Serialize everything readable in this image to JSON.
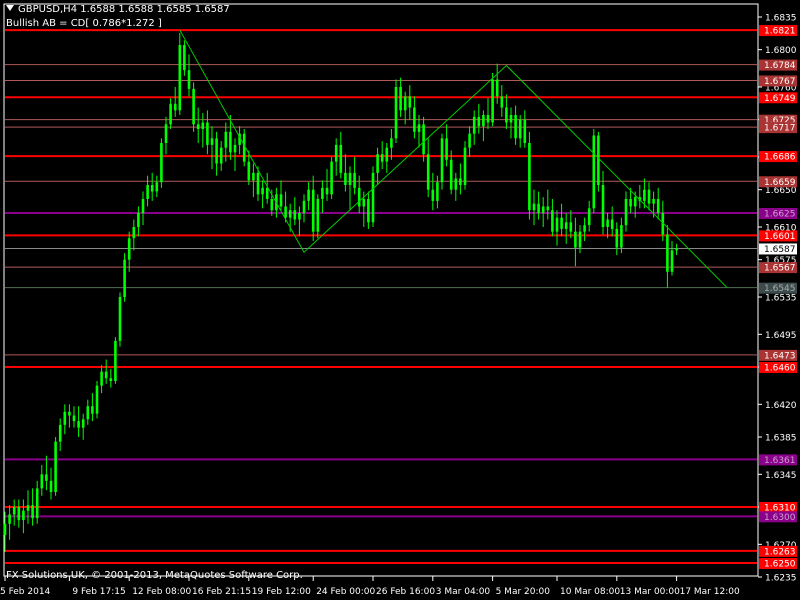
{
  "header": {
    "title": "GBPUSD,H4  1.6588 1.6588 1.6585 1.6587",
    "indicator_label": "Bullish AB = CD[ 0.786*1.272 ]"
  },
  "footer": {
    "copyright": "FX Solutions UK, © 2001-2013, MetaQuotes Software Corp."
  },
  "colors": {
    "background": "#000000",
    "candle": "#00ff00",
    "axis": "#ffffff",
    "grid_red": "#ff0000",
    "level_dim": "#b05a5a",
    "level_purple": "#8b008b",
    "pattern": "#00cc00",
    "current_price_bg": "#ffffff"
  },
  "chart_data": {
    "type": "candlestick",
    "symbol": "GBPUSD",
    "timeframe": "H4",
    "ylim": [
      1.6235,
      1.6835
    ],
    "y_ticks": [
      "1.6835",
      "1.6800",
      "1.6760",
      "1.6725",
      "1.6685",
      "1.6650",
      "1.6610",
      "1.6575",
      "1.6535",
      "1.6495",
      "1.6460",
      "1.6420",
      "1.6385",
      "1.6345",
      "1.6310",
      "1.6270",
      "1.6235"
    ],
    "x_ticks": [
      {
        "index": 0,
        "label": "5 Feb 2014"
      },
      {
        "index": 14,
        "label": "9 Feb 17:15"
      },
      {
        "index": 27,
        "label": "12 Feb 08:00"
      },
      {
        "index": 40,
        "label": "16 Feb 21:15"
      },
      {
        "index": 53,
        "label": "19 Feb 12:00"
      },
      {
        "index": 67,
        "label": "24 Feb 00:00"
      },
      {
        "index": 80,
        "label": "26 Feb 16:00"
      },
      {
        "index": 93,
        "label": "3 Mar 04:00"
      },
      {
        "index": 106,
        "label": "5 Mar 20:00"
      },
      {
        "index": 120,
        "label": "10 Mar 08:00"
      },
      {
        "index": 133,
        "label": "13 Mar 00:00"
      },
      {
        "index": 146,
        "label": "17 Mar 12:00"
      }
    ],
    "candles": [
      [
        1.628,
        1.6305,
        1.6262,
        1.6292
      ],
      [
        1.6292,
        1.6312,
        1.6275,
        1.6302
      ],
      [
        1.6302,
        1.6318,
        1.629,
        1.631
      ],
      [
        1.631,
        1.6318,
        1.6288,
        1.6296
      ],
      [
        1.6296,
        1.6318,
        1.6282,
        1.6306
      ],
      [
        1.6306,
        1.6328,
        1.6292,
        1.6312
      ],
      [
        1.6312,
        1.633,
        1.629,
        1.6298
      ],
      [
        1.6298,
        1.6338,
        1.6292,
        1.633
      ],
      [
        1.633,
        1.6355,
        1.6322,
        1.6345
      ],
      [
        1.6345,
        1.6365,
        1.6328,
        1.6338
      ],
      [
        1.6338,
        1.6352,
        1.6318,
        1.6326
      ],
      [
        1.6326,
        1.6385,
        1.6322,
        1.638
      ],
      [
        1.638,
        1.6405,
        1.637,
        1.6398
      ],
      [
        1.6398,
        1.642,
        1.6388,
        1.6412
      ],
      [
        1.6412,
        1.642,
        1.6395,
        1.6408
      ],
      [
        1.6408,
        1.6418,
        1.6395,
        1.6402
      ],
      [
        1.6402,
        1.6418,
        1.6385,
        1.6395
      ],
      [
        1.6395,
        1.641,
        1.6382,
        1.6404
      ],
      [
        1.6404,
        1.6425,
        1.6398,
        1.6418
      ],
      [
        1.6418,
        1.6432,
        1.6402,
        1.641
      ],
      [
        1.641,
        1.6445,
        1.6405,
        1.644
      ],
      [
        1.644,
        1.6462,
        1.6432,
        1.6455
      ],
      [
        1.6455,
        1.6468,
        1.6442,
        1.6448
      ],
      [
        1.6448,
        1.6458,
        1.6438,
        1.6445
      ],
      [
        1.6445,
        1.6492,
        1.6442,
        1.6488
      ],
      [
        1.6488,
        1.654,
        1.6482,
        1.6535
      ],
      [
        1.6535,
        1.6582,
        1.653,
        1.6575
      ],
      [
        1.6575,
        1.6605,
        1.6562,
        1.6598
      ],
      [
        1.6598,
        1.6618,
        1.6585,
        1.661
      ],
      [
        1.661,
        1.6632,
        1.66,
        1.6625
      ],
      [
        1.6625,
        1.6648,
        1.6612,
        1.664
      ],
      [
        1.664,
        1.6665,
        1.6632,
        1.6655
      ],
      [
        1.6655,
        1.6668,
        1.6638,
        1.6648
      ],
      [
        1.6648,
        1.6665,
        1.6642,
        1.6658
      ],
      [
        1.6658,
        1.6705,
        1.6652,
        1.67
      ],
      [
        1.67,
        1.6728,
        1.6688,
        1.672
      ],
      [
        1.672,
        1.6748,
        1.6715,
        1.6742
      ],
      [
        1.6742,
        1.676,
        1.6728,
        1.6735
      ],
      [
        1.6735,
        1.6818,
        1.673,
        1.6805
      ],
      [
        1.6805,
        1.681,
        1.6772,
        1.6778
      ],
      [
        1.6778,
        1.6795,
        1.675,
        1.6758
      ],
      [
        1.6758,
        1.6765,
        1.6712,
        1.672
      ],
      [
        1.672,
        1.6738,
        1.67,
        1.6715
      ],
      [
        1.6715,
        1.6732,
        1.6695,
        1.6722
      ],
      [
        1.6722,
        1.6735,
        1.6688,
        1.6698
      ],
      [
        1.6698,
        1.6718,
        1.6672,
        1.6705
      ],
      [
        1.6705,
        1.6712,
        1.6665,
        1.6678
      ],
      [
        1.6678,
        1.6702,
        1.667,
        1.6695
      ],
      [
        1.6695,
        1.6722,
        1.668,
        1.6712
      ],
      [
        1.6712,
        1.673,
        1.6682,
        1.669
      ],
      [
        1.669,
        1.6705,
        1.667,
        1.6698
      ],
      [
        1.6698,
        1.6718,
        1.6688,
        1.671
      ],
      [
        1.671,
        1.6715,
        1.6675,
        1.668
      ],
      [
        1.668,
        1.6692,
        1.6655,
        1.666
      ],
      [
        1.666,
        1.6678,
        1.6642,
        1.6668
      ],
      [
        1.6668,
        1.6675,
        1.6638,
        1.6645
      ],
      [
        1.6645,
        1.666,
        1.663,
        1.6652
      ],
      [
        1.6652,
        1.6668,
        1.6635,
        1.664
      ],
      [
        1.664,
        1.665,
        1.6622,
        1.6628
      ],
      [
        1.6628,
        1.6652,
        1.662,
        1.6645
      ],
      [
        1.6645,
        1.666,
        1.6628,
        1.6632
      ],
      [
        1.6632,
        1.6648,
        1.6615,
        1.662
      ],
      [
        1.662,
        1.6635,
        1.6605,
        1.6628
      ],
      [
        1.6628,
        1.6642,
        1.6612,
        1.6618
      ],
      [
        1.6618,
        1.6632,
        1.66,
        1.6625
      ],
      [
        1.6625,
        1.6645,
        1.6615,
        1.6638
      ],
      [
        1.6638,
        1.6658,
        1.6628,
        1.665
      ],
      [
        1.665,
        1.6665,
        1.6595,
        1.6605
      ],
      [
        1.6605,
        1.6645,
        1.6598,
        1.664
      ],
      [
        1.664,
        1.666,
        1.6625,
        1.6652
      ],
      [
        1.6652,
        1.6672,
        1.6638,
        1.6645
      ],
      [
        1.6645,
        1.6685,
        1.664,
        1.668
      ],
      [
        1.668,
        1.6705,
        1.6665,
        1.6698
      ],
      [
        1.6698,
        1.6712,
        1.6662,
        1.6668
      ],
      [
        1.6668,
        1.6688,
        1.6648,
        1.6655
      ],
      [
        1.6655,
        1.6675,
        1.6628,
        1.6668
      ],
      [
        1.6668,
        1.6685,
        1.6645,
        1.6652
      ],
      [
        1.6652,
        1.6665,
        1.6625,
        1.6632
      ],
      [
        1.6632,
        1.6648,
        1.661,
        1.664
      ],
      [
        1.664,
        1.6648,
        1.6608,
        1.6615
      ],
      [
        1.6615,
        1.6675,
        1.661,
        1.6668
      ],
      [
        1.6668,
        1.6695,
        1.6655,
        1.6688
      ],
      [
        1.6688,
        1.6702,
        1.6672,
        1.668
      ],
      [
        1.668,
        1.67,
        1.6668,
        1.6695
      ],
      [
        1.6695,
        1.6715,
        1.6682,
        1.6705
      ],
      [
        1.6705,
        1.6768,
        1.67,
        1.676
      ],
      [
        1.676,
        1.677,
        1.6728,
        1.6735
      ],
      [
        1.6735,
        1.6755,
        1.672,
        1.675
      ],
      [
        1.675,
        1.6762,
        1.6725,
        1.6738
      ],
      [
        1.6738,
        1.675,
        1.6705,
        1.6712
      ],
      [
        1.6712,
        1.673,
        1.6695,
        1.672
      ],
      [
        1.672,
        1.6728,
        1.668,
        1.6688
      ],
      [
        1.6688,
        1.6705,
        1.6642,
        1.665
      ],
      [
        1.665,
        1.6668,
        1.6628,
        1.6638
      ],
      [
        1.6638,
        1.6665,
        1.663,
        1.6658
      ],
      [
        1.6658,
        1.671,
        1.665,
        1.6705
      ],
      [
        1.6705,
        1.672,
        1.6675,
        1.6682
      ],
      [
        1.6682,
        1.6692,
        1.6645,
        1.665
      ],
      [
        1.665,
        1.6668,
        1.6638,
        1.6662
      ],
      [
        1.6662,
        1.6678,
        1.6645,
        1.6655
      ],
      [
        1.6655,
        1.6702,
        1.665,
        1.6695
      ],
      [
        1.6695,
        1.6718,
        1.6685,
        1.671
      ],
      [
        1.671,
        1.6735,
        1.6698,
        1.6728
      ],
      [
        1.6728,
        1.6742,
        1.671,
        1.6718
      ],
      [
        1.6718,
        1.6735,
        1.6702,
        1.673
      ],
      [
        1.673,
        1.6748,
        1.6715,
        1.6722
      ],
      [
        1.6722,
        1.6775,
        1.6718,
        1.6768
      ],
      [
        1.6768,
        1.6785,
        1.6742,
        1.675
      ],
      [
        1.675,
        1.6762,
        1.6728,
        1.6738
      ],
      [
        1.6738,
        1.6752,
        1.6715,
        1.6722
      ],
      [
        1.6722,
        1.6738,
        1.6705,
        1.673
      ],
      [
        1.673,
        1.674,
        1.6698,
        1.6705
      ],
      [
        1.6705,
        1.673,
        1.6695,
        1.6725
      ],
      [
        1.6725,
        1.6735,
        1.6695,
        1.67
      ],
      [
        1.67,
        1.6712,
        1.6618,
        1.6628
      ],
      [
        1.6628,
        1.665,
        1.6612,
        1.6635
      ],
      [
        1.6635,
        1.6648,
        1.6618,
        1.6625
      ],
      [
        1.6625,
        1.6642,
        1.661,
        1.6632
      ],
      [
        1.6632,
        1.665,
        1.6618,
        1.6628
      ],
      [
        1.6628,
        1.664,
        1.66,
        1.6605
      ],
      [
        1.6605,
        1.6628,
        1.659,
        1.662
      ],
      [
        1.662,
        1.6635,
        1.66,
        1.6608
      ],
      [
        1.6608,
        1.6625,
        1.6592,
        1.6615
      ],
      [
        1.6615,
        1.6628,
        1.6598,
        1.6605
      ],
      [
        1.6605,
        1.662,
        1.6568,
        1.6588
      ],
      [
        1.6588,
        1.6612,
        1.6582,
        1.6605
      ],
      [
        1.6605,
        1.662,
        1.6595,
        1.6612
      ],
      [
        1.6612,
        1.6638,
        1.6605,
        1.663
      ],
      [
        1.663,
        1.6715,
        1.6625,
        1.6708
      ],
      [
        1.6708,
        1.6712,
        1.6648,
        1.6655
      ],
      [
        1.6655,
        1.667,
        1.6602,
        1.661
      ],
      [
        1.661,
        1.6625,
        1.6598,
        1.6618
      ],
      [
        1.6618,
        1.6632,
        1.66,
        1.6608
      ],
      [
        1.6608,
        1.6615,
        1.658,
        1.6588
      ],
      [
        1.6588,
        1.662,
        1.6582,
        1.6612
      ],
      [
        1.6612,
        1.6648,
        1.6605,
        1.664
      ],
      [
        1.664,
        1.6652,
        1.6625,
        1.6632
      ],
      [
        1.6632,
        1.6648,
        1.662,
        1.6642
      ],
      [
        1.6642,
        1.6655,
        1.663,
        1.6638
      ],
      [
        1.6638,
        1.6662,
        1.663,
        1.665
      ],
      [
        1.665,
        1.6658,
        1.6628,
        1.6635
      ],
      [
        1.6635,
        1.6648,
        1.662,
        1.664
      ],
      [
        1.664,
        1.6652,
        1.6618,
        1.6625
      ],
      [
        1.6625,
        1.6638,
        1.6595,
        1.6602
      ],
      [
        1.6602,
        1.6612,
        1.6545,
        1.6562
      ],
      [
        1.6562,
        1.6595,
        1.6558,
        1.6585
      ],
      [
        1.6585,
        1.6592,
        1.658,
        1.6587
      ]
    ],
    "levels": [
      {
        "price": 1.6821,
        "style": "red",
        "label": "1.6821"
      },
      {
        "price": 1.6784,
        "style": "dim",
        "label": "1.6784"
      },
      {
        "price": 1.6767,
        "style": "dim",
        "label": "1.6767"
      },
      {
        "price": 1.6749,
        "style": "red",
        "label": "1.6749"
      },
      {
        "price": 1.6725,
        "style": "dim",
        "label": "1.6725"
      },
      {
        "price": 1.6717,
        "style": "dim",
        "label": "1.6717"
      },
      {
        "price": 1.6686,
        "style": "red",
        "label": "1.6686"
      },
      {
        "price": 1.6659,
        "style": "dim",
        "label": "1.6659"
      },
      {
        "price": 1.6625,
        "style": "purple",
        "label": "1.6625"
      },
      {
        "price": 1.6601,
        "style": "red",
        "label": "1.6601"
      },
      {
        "price": 1.6587,
        "style": "current",
        "label": "1.6587"
      },
      {
        "price": 1.6567,
        "style": "dim",
        "label": "1.6567"
      },
      {
        "price": 1.6545,
        "style": "gray",
        "label": "1.6545"
      },
      {
        "price": 1.6473,
        "style": "dim",
        "label": "1.6473"
      },
      {
        "price": 1.646,
        "style": "red",
        "label": "1.6460"
      },
      {
        "price": 1.6361,
        "style": "purple",
        "label": "1.6361"
      },
      {
        "price": 1.631,
        "style": "red",
        "label": "1.6310"
      },
      {
        "price": 1.63,
        "style": "purple",
        "label": "1.6300"
      },
      {
        "price": 1.6263,
        "style": "red",
        "label": "1.6263"
      },
      {
        "price": 1.625,
        "style": "red",
        "label": "1.6250"
      }
    ],
    "pattern": [
      {
        "index": 38,
        "price": 1.6821
      },
      {
        "index": 65,
        "price": 1.6583
      },
      {
        "index": 109,
        "price": 1.6783
      },
      {
        "index": 157,
        "price": 1.6545
      }
    ]
  }
}
